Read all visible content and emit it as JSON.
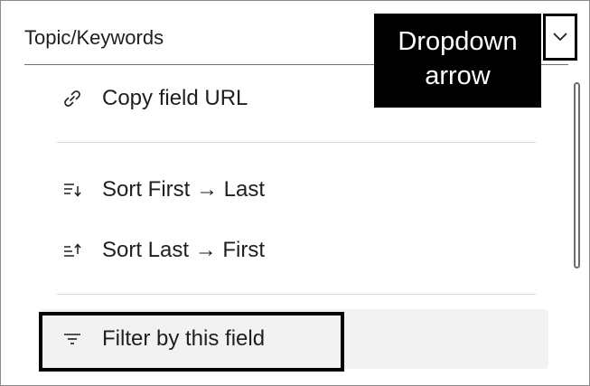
{
  "header": {
    "title": "Topic/Keywords"
  },
  "callout": {
    "line1": "Dropdown",
    "line2": "arrow"
  },
  "menu": {
    "copy_url": "Copy field URL",
    "sort_asc": "Sort  First → Last",
    "sort_desc": "Sort  Last → First",
    "filter": "Filter by this field"
  },
  "icons": {
    "dropdown": "chevron-down-icon",
    "copy": "link-icon",
    "sort_asc": "sort-ascending-icon",
    "sort_desc": "sort-descending-icon",
    "filter": "filter-icon"
  },
  "colors": {
    "text": "#1f1f1f",
    "callout_bg": "#000000",
    "callout_text": "#ffffff",
    "hover_bg": "#f2f2f2"
  }
}
